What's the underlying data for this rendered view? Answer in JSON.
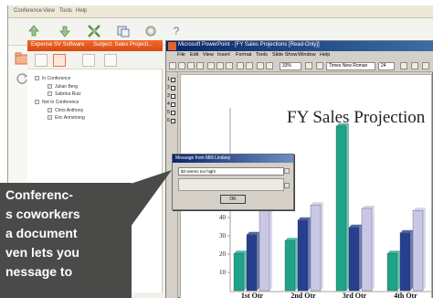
{
  "app": {
    "menu": [
      "Conference",
      "View",
      "Tools",
      "Help"
    ],
    "toolbar_icons": [
      "upload-icon",
      "download-icon",
      "share-icon",
      "copy-icon",
      "settings-icon",
      "help-icon"
    ],
    "help_glyph": "?"
  },
  "conference_panel": {
    "tabs": [
      "Expense SV Software",
      "Subject: Sales Projecti..."
    ],
    "tree": [
      {
        "label": "In Conference",
        "level": 0
      },
      {
        "label": "Julian Berg",
        "level": 1
      },
      {
        "label": "Sabrina Ruiz",
        "level": 1
      },
      {
        "label": "Not In Conference",
        "level": 0
      },
      {
        "label": "Chris Anthony",
        "level": 1
      },
      {
        "label": "Eric Armstrong",
        "level": 1
      }
    ]
  },
  "powerpoint": {
    "title": "Microsoft PowerPoint - [FY Sales Projections [Read-Only]]",
    "menu": [
      "File",
      "Edit",
      "View",
      "Insert",
      "Format",
      "Tools",
      "Slide Show",
      "Window",
      "Help"
    ],
    "zoom": "33%",
    "font": "Times New Roman",
    "font_size": "24",
    "slide_numbers": [
      "1",
      "2",
      "3",
      "4",
      "5",
      "6"
    ]
  },
  "slide": {
    "title": "FY Sales Projection"
  },
  "chart_data": {
    "type": "bar",
    "categories": [
      "1st Qtr",
      "2nd Qtr",
      "3rd Qtr",
      "4th Qtr"
    ],
    "series": [
      {
        "values": [
          20.4,
          27.4,
          90,
          20.4
        ],
        "color": "#1fa389"
      },
      {
        "values": [
          30.6,
          38.6,
          34.6,
          31.6
        ],
        "color": "#26408f"
      },
      {
        "values": [
          45.9,
          46.9,
          45,
          43.9
        ],
        "color": "#c8c8e6"
      }
    ],
    "yticks": [
      10,
      20,
      30,
      40
    ],
    "ylim": [
      0,
      100
    ]
  },
  "message_dialog": {
    "title": "Message from Milli Lindsey",
    "message": "$3 seems too high!",
    "ok_label": "OK"
  },
  "callout": {
    "lines": [
      "Conferenc-",
      "s coworkers",
      "a document",
      "ven lets you",
      "nessage to"
    ]
  }
}
